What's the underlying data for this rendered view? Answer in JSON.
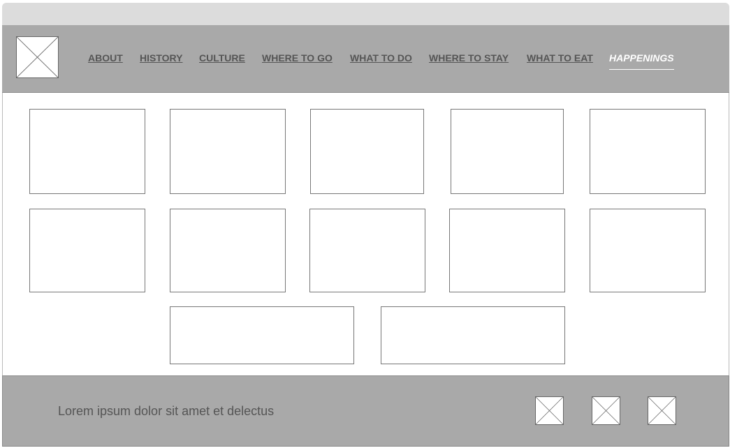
{
  "nav": {
    "items": [
      {
        "label": "ABOUT"
      },
      {
        "label": "HISTORY"
      },
      {
        "label": "CULTURE"
      },
      {
        "label": "WHERE TO GO"
      },
      {
        "label": "WHAT TO DO"
      },
      {
        "label": "WHERE TO STAY"
      },
      {
        "label": "WHAT TO EAT"
      },
      {
        "label": "HAPPENINGS",
        "active": true
      }
    ]
  },
  "logo": {
    "icon": "image-placeholder-icon"
  },
  "footer": {
    "text": "Lorem ipsum dolor sit amet et delectus",
    "social_icons": [
      "image-placeholder-icon",
      "image-placeholder-icon",
      "image-placeholder-icon"
    ]
  },
  "colors": {
    "header_bg": "#a9a9a9",
    "nav_text": "#555555",
    "nav_active": "#ffffff",
    "browser_bar": "#dcdcdc"
  }
}
